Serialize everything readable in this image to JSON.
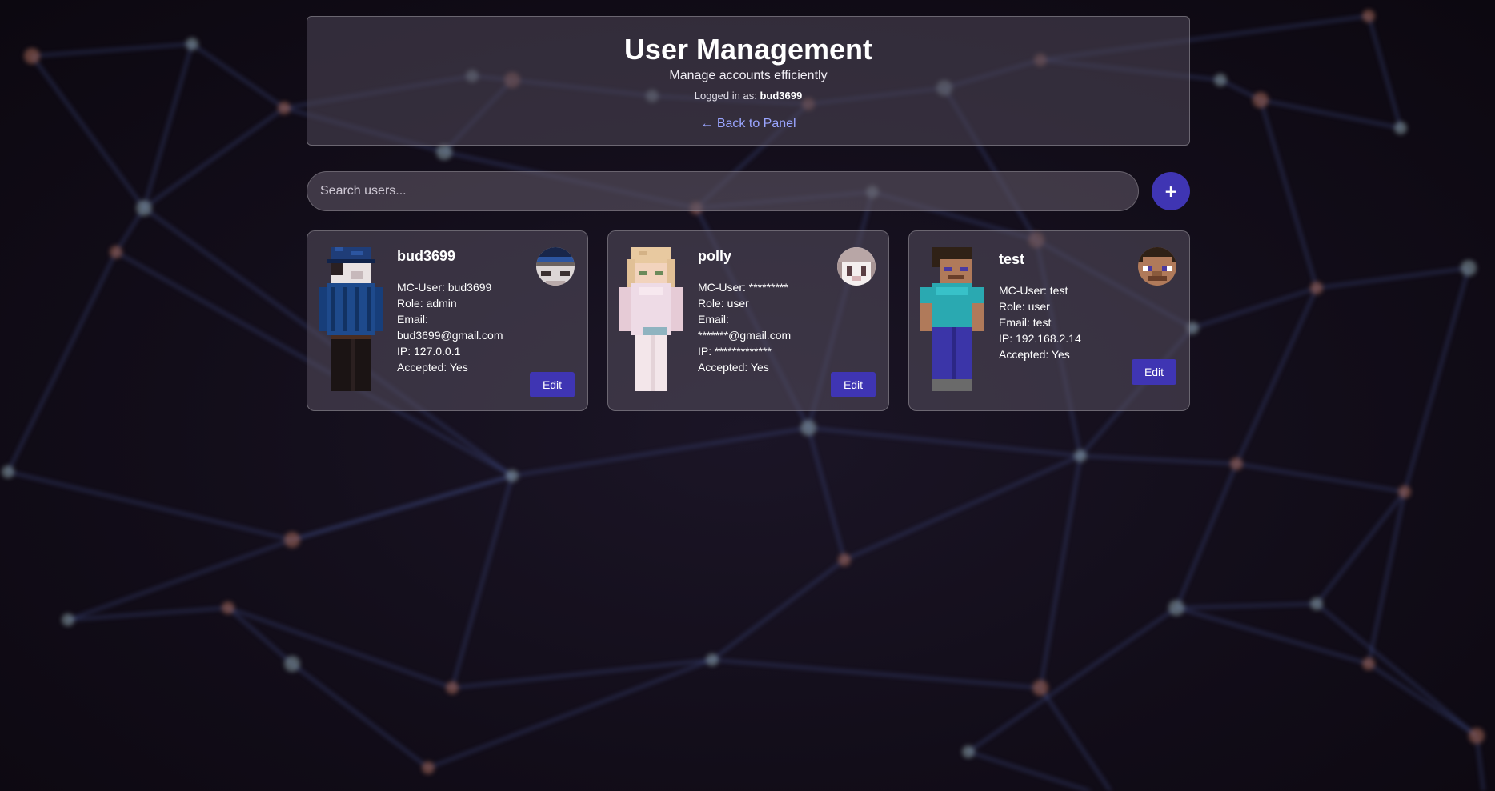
{
  "header": {
    "title": "User Management",
    "subtitle": "Manage accounts efficiently",
    "logged_in_prefix": "Logged in as:",
    "logged_in_user": "bud3699",
    "back_link": "← Back to Panel"
  },
  "search": {
    "placeholder": "Search users...",
    "value": ""
  },
  "add_button": {
    "label": "+"
  },
  "colors": {
    "accent": "#3f35b3",
    "link": "#9aa5ff"
  },
  "users": [
    {
      "username": "bud3699",
      "mc_user": "MC-User: bud3699",
      "role": "Role: admin",
      "email_label": "Email:",
      "email": "bud3699@gmail.com",
      "ip": "IP: 127.0.0.1",
      "accepted": "Accepted: Yes",
      "edit_label": "Edit",
      "skin": "blue-police-skin"
    },
    {
      "username": "polly",
      "mc_user": "MC-User: *********",
      "role": "Role: user",
      "email_label": "Email:",
      "email": "*******@gmail.com",
      "ip": "IP: *************",
      "accepted": "Accepted: Yes",
      "edit_label": "Edit",
      "skin": "blonde-pink-skin"
    },
    {
      "username": "test",
      "mc_user": "MC-User: test",
      "role": "Role: user",
      "email": "Email: test",
      "ip": "IP: 192.168.2.14",
      "accepted": "Accepted: Yes",
      "edit_label": "Edit",
      "skin": "steve-skin"
    }
  ]
}
